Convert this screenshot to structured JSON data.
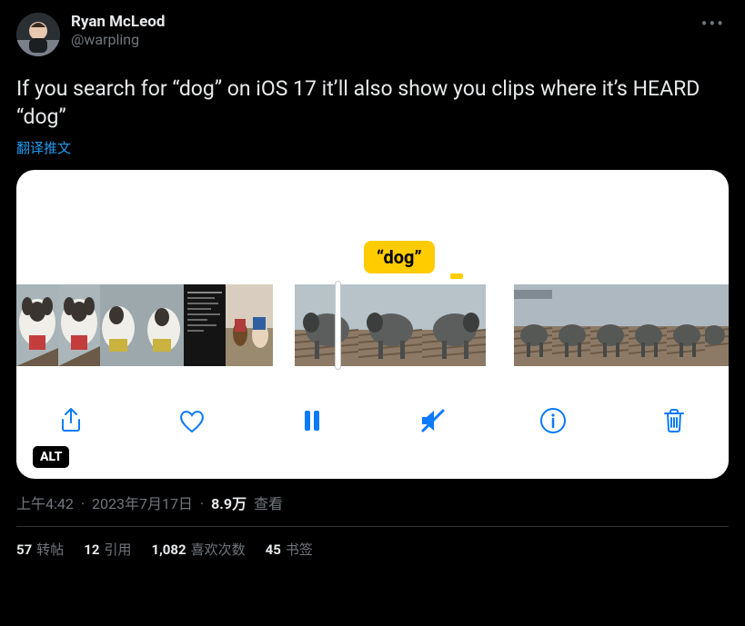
{
  "author": {
    "display_name": "Ryan McLeod",
    "handle": "@warpling"
  },
  "tweet_text": "If you search for “dog” on iOS 17 it’ll also show you clips where it’s HEARD “dog”",
  "translate_label": "翻译推文",
  "media": {
    "bubble_label": "“dog”",
    "alt_badge": "ALT",
    "toolbar": {
      "share": "share",
      "like": "like",
      "pause": "pause",
      "mute": "mute",
      "info": "info",
      "trash": "trash"
    }
  },
  "meta": {
    "time": "上午4:42",
    "date": "2023年7月17日",
    "views_number": "8.9万",
    "views_label": "查看"
  },
  "stats": {
    "retweets_count": "57",
    "retweets_label": "转帖",
    "quotes_count": "12",
    "quotes_label": "引用",
    "likes_count": "1,082",
    "likes_label": "喜欢次数",
    "bookmarks_count": "45",
    "bookmarks_label": "书签"
  }
}
